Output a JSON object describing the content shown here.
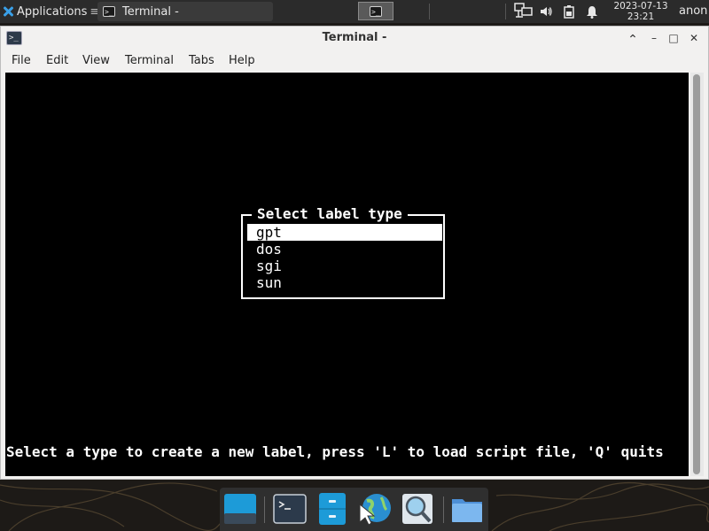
{
  "top_panel": {
    "applications_label": "Applications",
    "applications_suffix": "≡",
    "task_button_label": "Terminal -",
    "clock_date": "2023-07-13",
    "clock_time": "23:21",
    "user_name": "anon",
    "icons": {
      "applications": "xfce-logo-icon",
      "task": "terminal-icon",
      "workspace": "terminal-icon",
      "network": "network-icon",
      "volume": "speaker-icon",
      "battery": "battery-icon",
      "notifications": "bell-icon"
    }
  },
  "window": {
    "title": "Terminal -",
    "icon": "terminal-icon",
    "controls": [
      "⌃",
      "–",
      "□",
      "✕"
    ],
    "menu": [
      "File",
      "Edit",
      "View",
      "Terminal",
      "Tabs",
      "Help"
    ]
  },
  "terminal": {
    "dialog_title": "Select label type",
    "options": [
      "gpt",
      "dos",
      "sgi",
      "sun"
    ],
    "selected_index": 0,
    "status_line": "Select a type to create a new label, press 'L' to load script file, 'Q' quits",
    "background": "#000000",
    "foreground": "#ffffff"
  },
  "dock": {
    "items": [
      "show-desktop-icon",
      "terminal-icon",
      "file-cabinet-icon",
      "web-browser-icon",
      "search-icon",
      "folder-icon"
    ]
  },
  "colors": {
    "panel": "#2b2b2b",
    "accent": "#3aa0e8",
    "window_bg": "#f2f1f0"
  }
}
